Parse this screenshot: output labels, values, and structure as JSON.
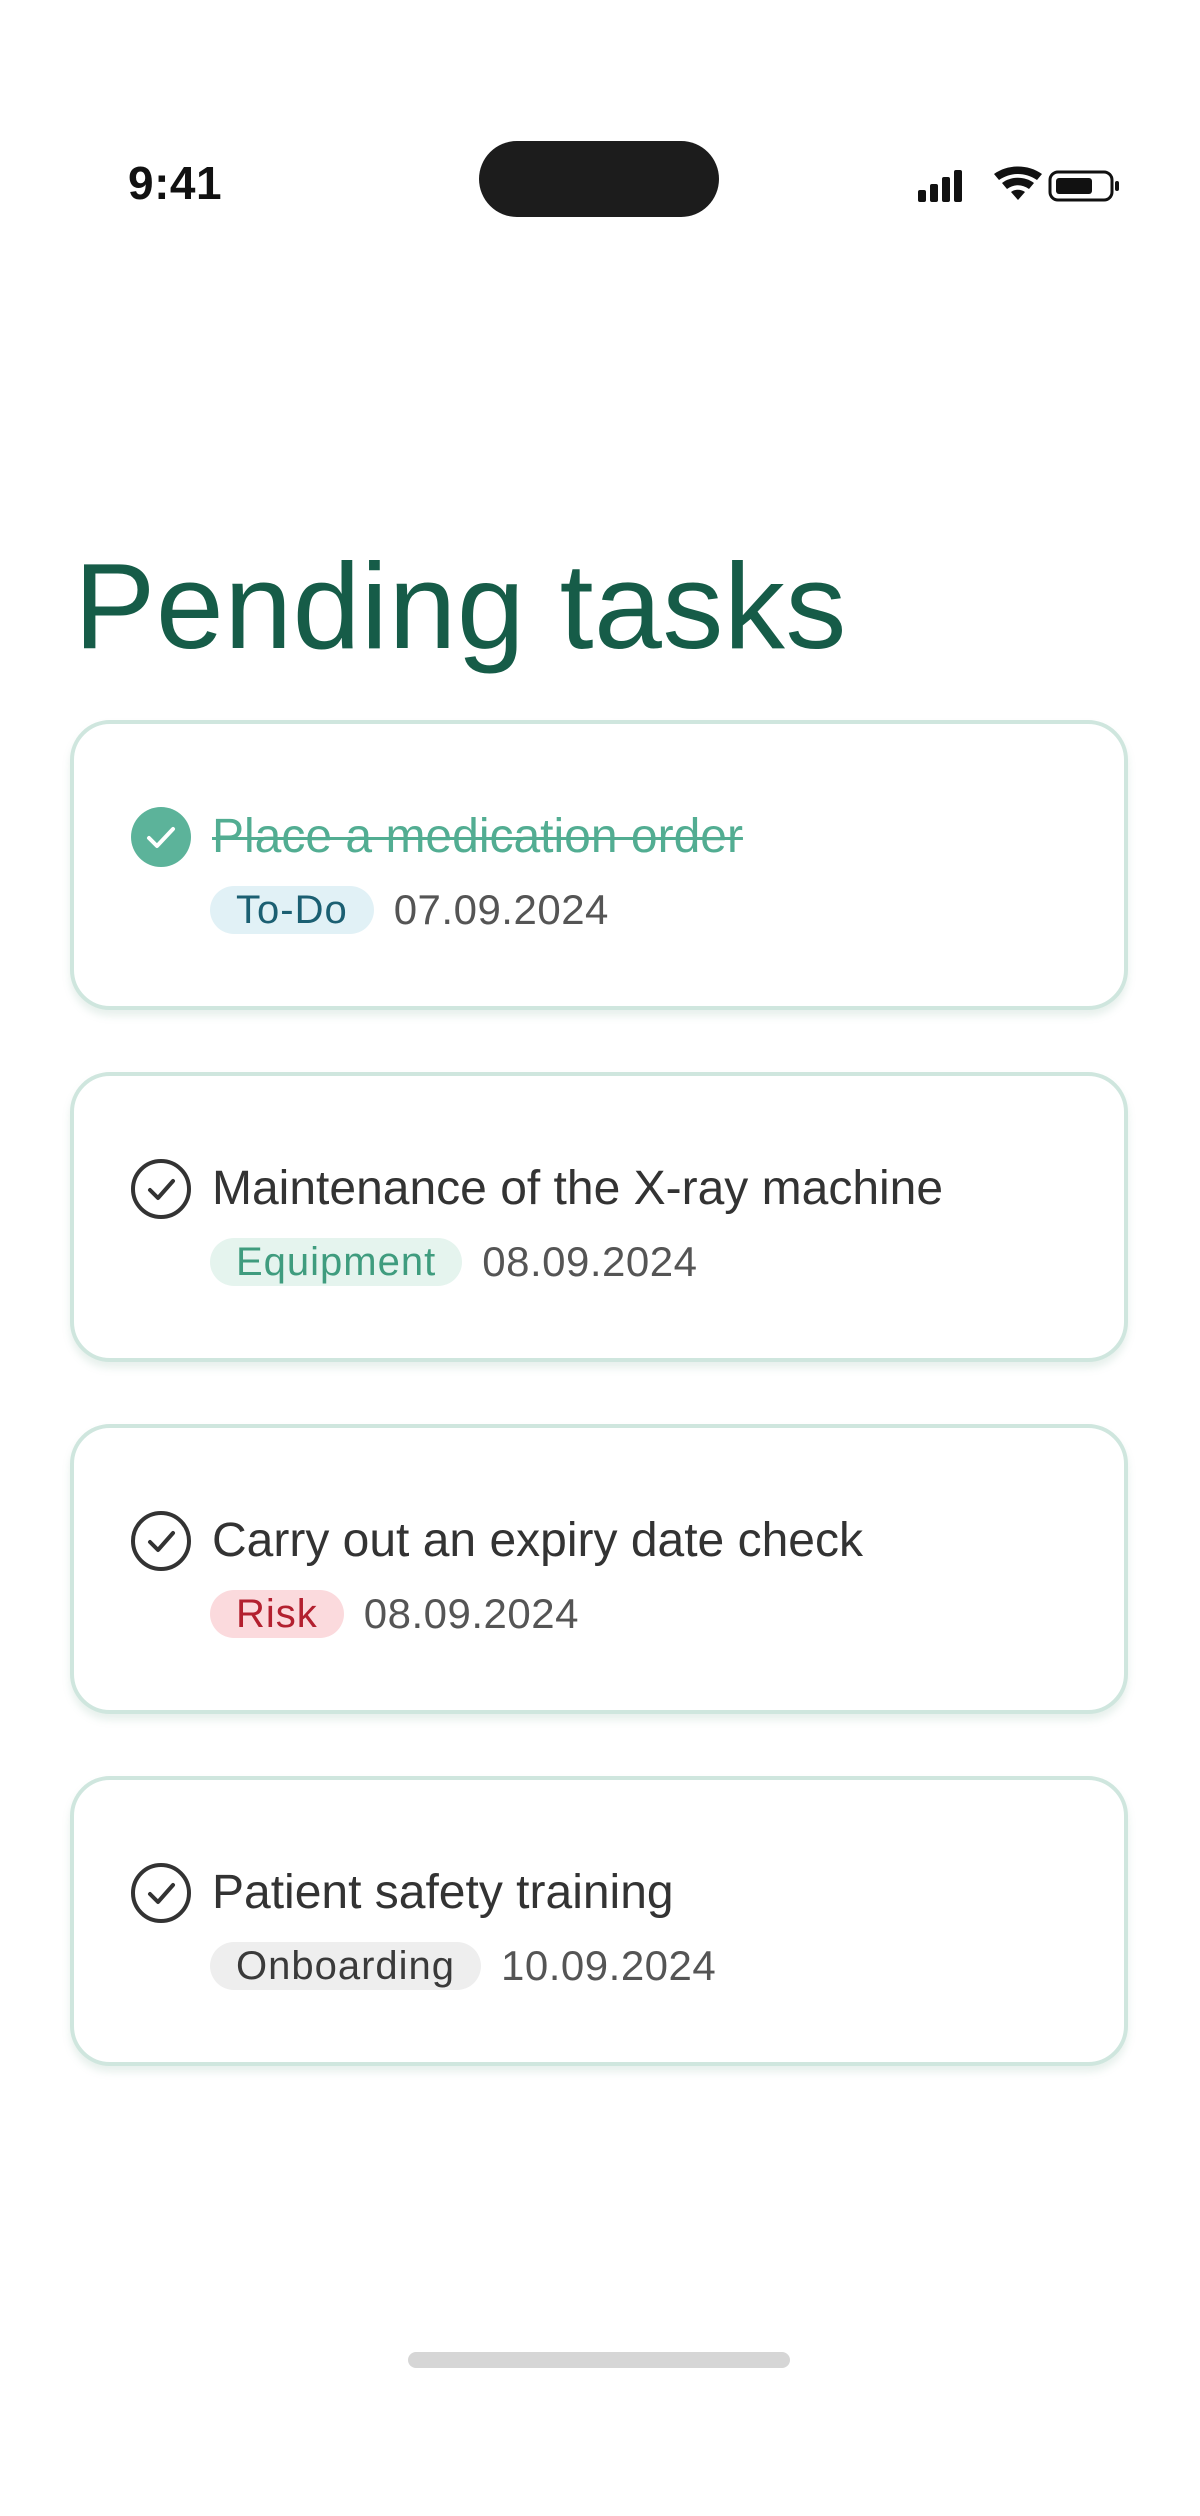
{
  "status_bar": {
    "time": "9:41",
    "icons": [
      "cellular-signal-icon",
      "wifi-icon",
      "battery-icon"
    ]
  },
  "page": {
    "title": "Pending tasks"
  },
  "colors": {
    "title": "#165c48",
    "card_border": "#cfe6de",
    "done_check": "#5cb39a",
    "done_text": "#52ad92"
  },
  "tasks": [
    {
      "title": "Place a medication order",
      "done": true,
      "tag": "To-Do",
      "tag_kind": "todo",
      "date": "07.09.2024"
    },
    {
      "title": "Maintenance of the X-ray machine",
      "done": false,
      "tag": "Equipment",
      "tag_kind": "equipment",
      "date": "08.09.2024"
    },
    {
      "title": "Carry out an expiry date check",
      "done": false,
      "tag": "Risk",
      "tag_kind": "risk",
      "date": "08.09.2024"
    },
    {
      "title": "Patient safety training",
      "done": false,
      "tag": "Onboarding",
      "tag_kind": "onboarding",
      "date": "10.09.2024"
    }
  ]
}
